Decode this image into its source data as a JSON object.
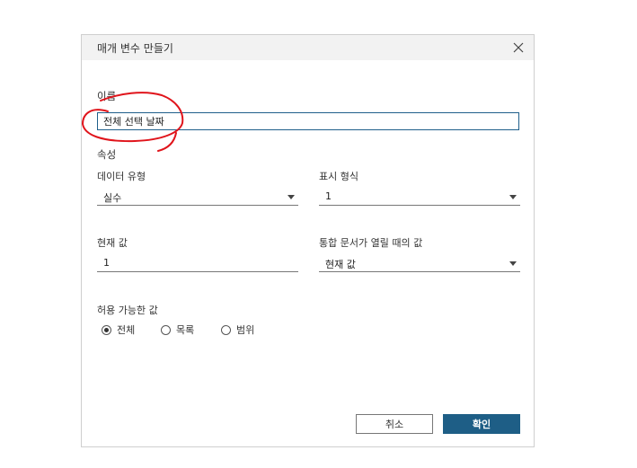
{
  "dialog": {
    "title": "매개 변수 만들기",
    "close_icon": "close-icon"
  },
  "name": {
    "label": "이름",
    "value": "전체 선택 날짜"
  },
  "properties": {
    "label": "속성",
    "data_type": {
      "label": "데이터 유형",
      "value": "실수"
    },
    "display_format": {
      "label": "표시 형식",
      "value": "1"
    },
    "current_value": {
      "label": "현재 값",
      "value": "1"
    },
    "workbook_open_value": {
      "label": "통합 문서가 열릴 때의 값",
      "value": "현재 값"
    }
  },
  "allowable": {
    "label": "허용 가능한 값",
    "options": [
      {
        "label": "전체",
        "selected": true
      },
      {
        "label": "목록",
        "selected": false
      },
      {
        "label": "범위",
        "selected": false
      }
    ]
  },
  "buttons": {
    "cancel": "취소",
    "ok": "확인"
  },
  "colors": {
    "accent": "#1e5e86",
    "annotation": "#e0141b"
  }
}
